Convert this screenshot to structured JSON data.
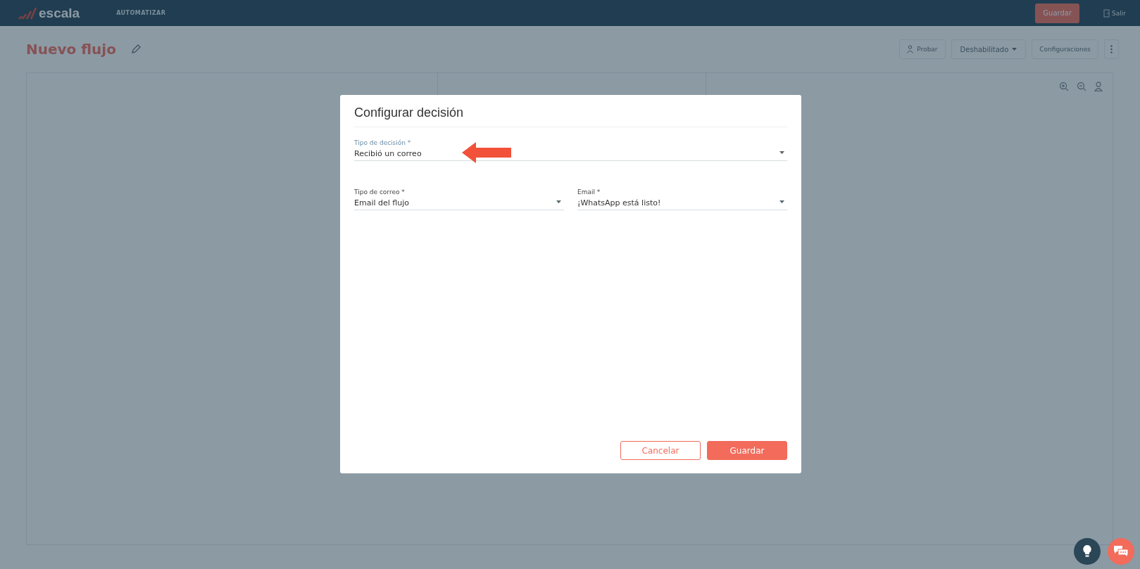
{
  "topbar": {
    "logo": "escala",
    "nav": [
      {
        "label": "AUTOMATIZAR",
        "selected": true
      }
    ],
    "save_button": "Guardar",
    "exit_button": "Salir"
  },
  "header": {
    "title": "Nuevo flujo",
    "test_button": "Probar",
    "status": {
      "value": "Deshabilitado"
    },
    "settings_button": "Configuraciones"
  },
  "dialog": {
    "title": "Configurar decisión",
    "rows": [
      [
        {
          "label": "Tipo de decisión *",
          "value": "Recibió un correo",
          "focused": true
        }
      ],
      [
        {
          "label": "Tipo de correo *",
          "value": "Email del flujo",
          "focused": false
        },
        {
          "label": "Email *",
          "value": "¡WhatsApp está listo!",
          "focused": false
        }
      ]
    ],
    "buttons": [
      {
        "label": "Cancelar",
        "kind": "secondary"
      },
      {
        "label": "Guardar",
        "kind": "primary"
      }
    ]
  }
}
